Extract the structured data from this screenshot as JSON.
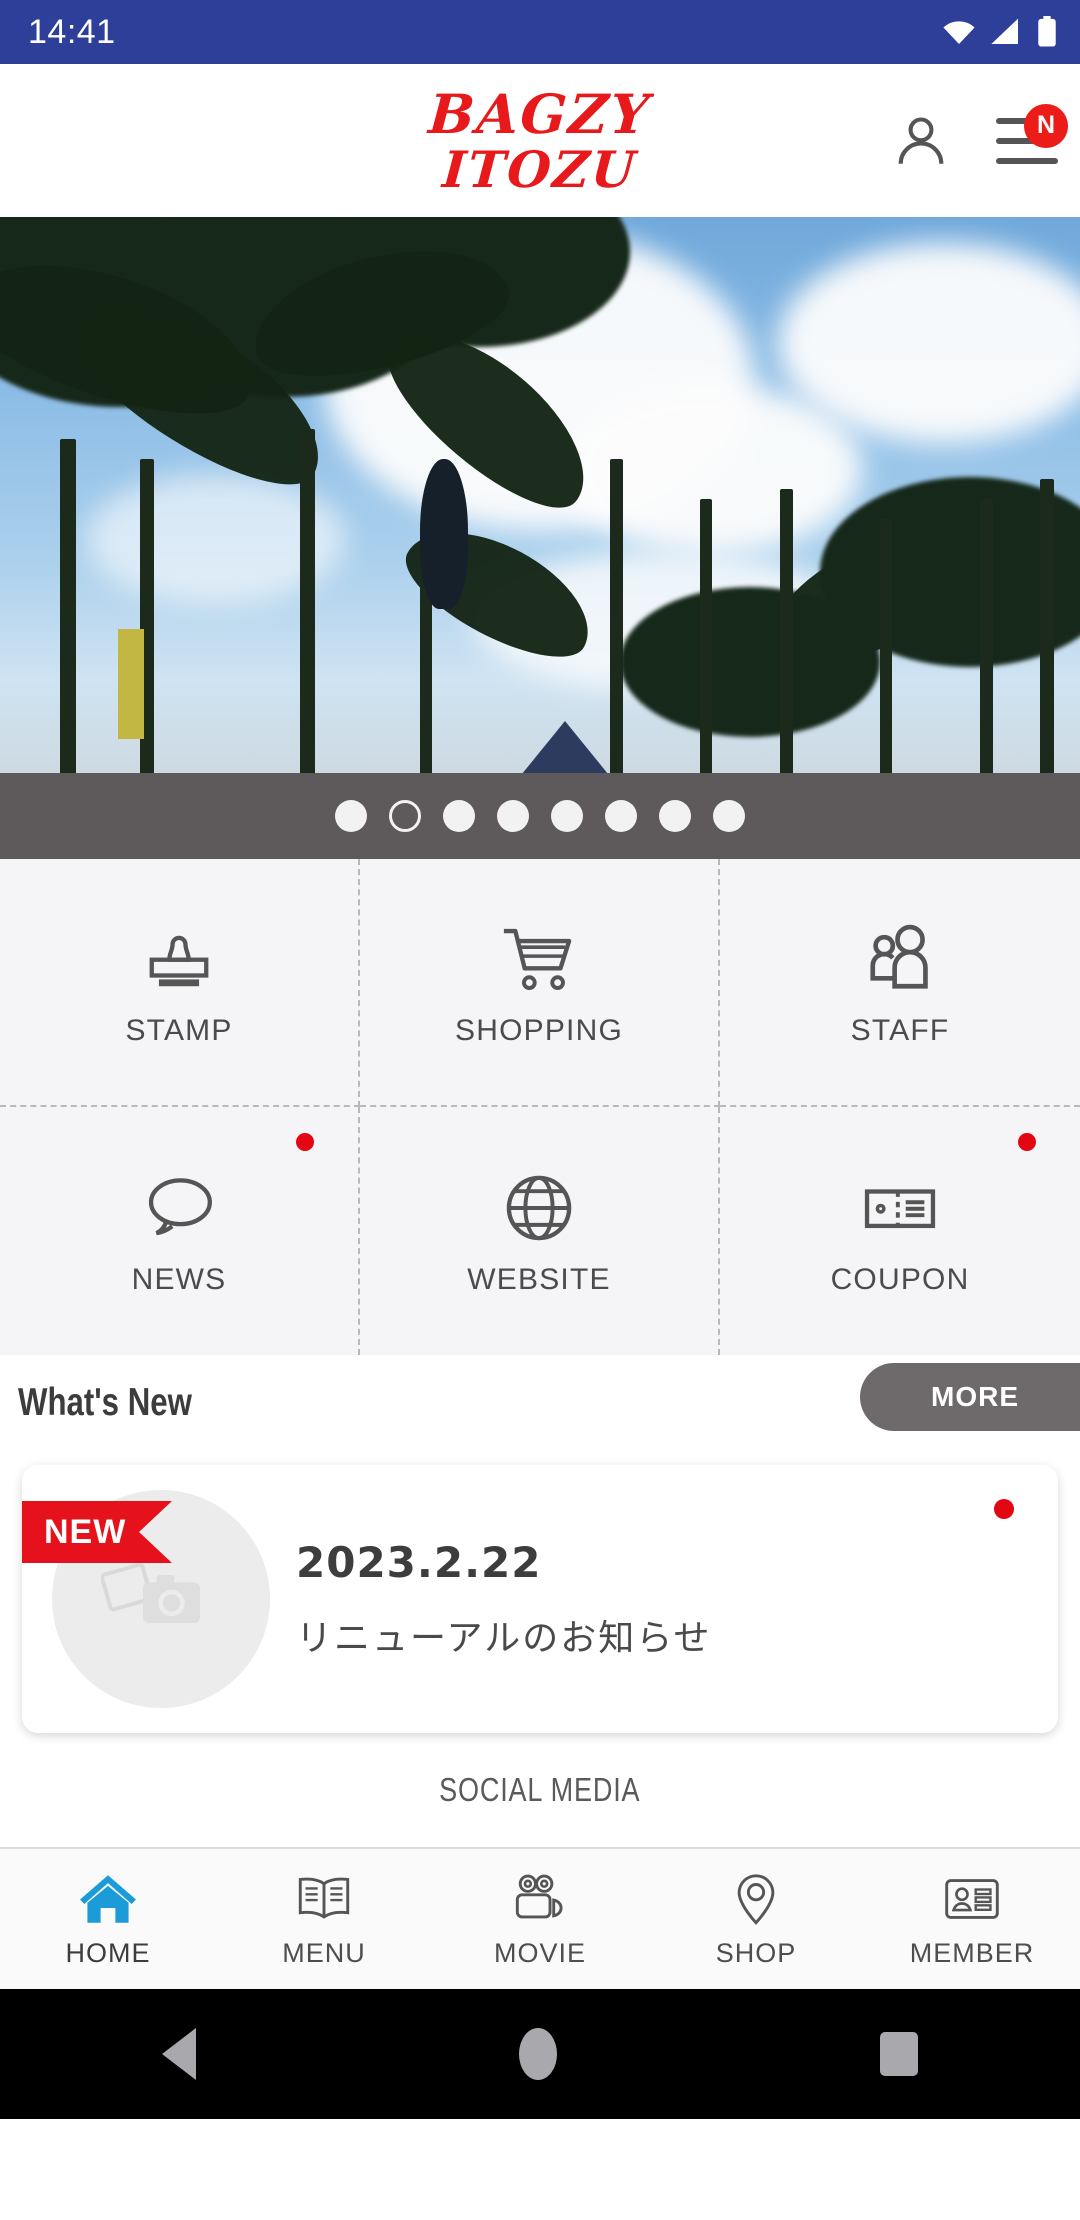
{
  "status_bar": {
    "time": "14:41",
    "icons": [
      "wifi-icon",
      "signal-icon",
      "battery-icon"
    ]
  },
  "header": {
    "logo_line1": "BAGZY",
    "logo_line2": "ITOZU",
    "logo_color": "#e8191b",
    "account_icon": "person-icon",
    "menu_icon": "hamburger-menu-icon",
    "menu_badge": "N",
    "menu_badge_color": "#ec1c18"
  },
  "carousel": {
    "slide_count": 8,
    "active_index": 1,
    "alt": "Palm trees on a tropical beach under a blue sky",
    "dots_bar_color": "#5e595b"
  },
  "quick_grid": {
    "items": [
      {
        "label": "STAMP",
        "icon": "stamp-icon",
        "badge": false
      },
      {
        "label": "SHOPPING",
        "icon": "shopping-cart-icon",
        "badge": false
      },
      {
        "label": "STAFF",
        "icon": "people-icon",
        "badge": false
      },
      {
        "label": "NEWS",
        "icon": "speech-bubble-icon",
        "badge": true
      },
      {
        "label": "WEBSITE",
        "icon": "globe-icon",
        "badge": false
      },
      {
        "label": "COUPON",
        "icon": "ticket-icon",
        "badge": true
      }
    ],
    "badge_color": "#e30613"
  },
  "whats_new": {
    "title": "What's New",
    "more_label": "MORE",
    "more_color": "#6e6a6c",
    "items": [
      {
        "ribbon": "NEW",
        "ribbon_color": "#e5121b",
        "date": "2023.2.22",
        "subject": "リニューアルのお知らせ",
        "thumbnail_icon": "photo-placeholder-icon",
        "unread": true
      }
    ]
  },
  "social_media": {
    "heading": "SOCIAL MEDIA"
  },
  "bottom_nav": {
    "active": "HOME",
    "active_color": "#1b9cd8",
    "items": [
      {
        "label": "HOME",
        "icon": "home-icon"
      },
      {
        "label": "MENU",
        "icon": "open-book-icon"
      },
      {
        "label": "MOVIE",
        "icon": "video-camera-icon"
      },
      {
        "label": "SHOP",
        "icon": "map-pin-icon"
      },
      {
        "label": "MEMBER",
        "icon": "id-card-icon"
      }
    ]
  },
  "system_nav": {
    "back": "back-triangle-icon",
    "home": "home-circle-icon",
    "recents": "recents-square-icon"
  }
}
